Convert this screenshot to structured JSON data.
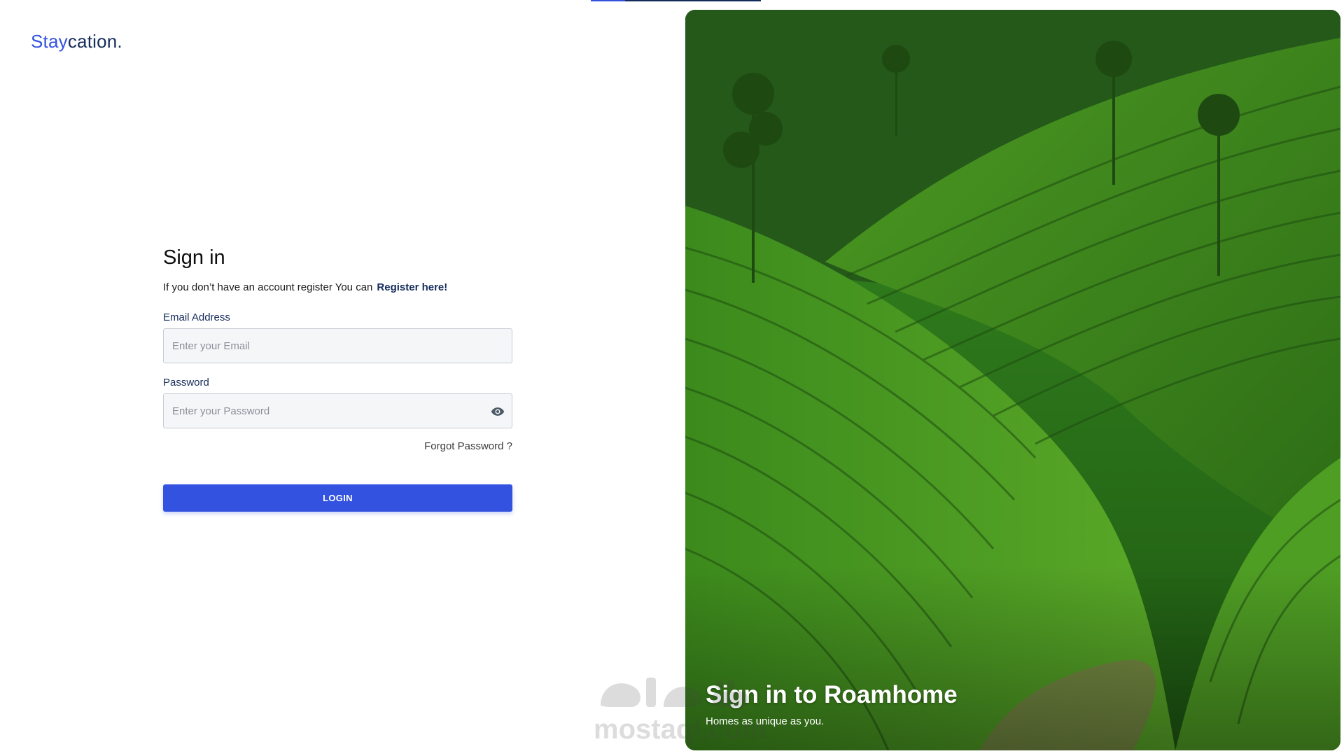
{
  "brand": {
    "part1": "Stay",
    "part2": "cation."
  },
  "signin": {
    "title": "Sign in",
    "subtitle": "If you don’t have an account register You can",
    "register_link": "Register here!",
    "email_label": "Email Address",
    "email_placeholder": "Enter your Email",
    "password_label": "Password",
    "password_placeholder": "Enter your Password",
    "forgot_link": "Forgot Password ?",
    "login_button": "LOGIN"
  },
  "hero": {
    "title": "Sign in to Roamhome",
    "subtitle": "Homes as unique as you."
  },
  "watermark": {
    "text": "mostaql.com"
  },
  "icons": {
    "password_toggle": "eye-icon"
  },
  "colors": {
    "primary": "#3252df",
    "navy": "#152c5b",
    "background": "#ffffff",
    "input_bg": "#f5f6f8"
  }
}
